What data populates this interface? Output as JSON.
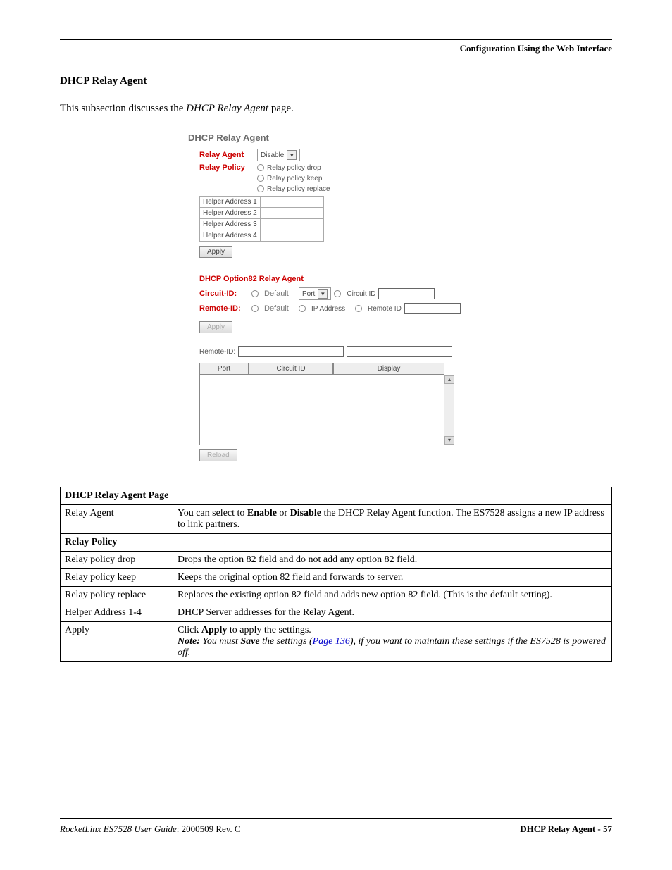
{
  "header": {
    "right": "Configuration Using the Web Interface"
  },
  "section": {
    "title": "DHCP Relay Agent",
    "intro": {
      "pre": "This subsection discusses the ",
      "page_name": "DHCP Relay Agent",
      "post": " page."
    }
  },
  "ui": {
    "title": "DHCP Relay Agent",
    "relay_agent_label": "Relay Agent",
    "relay_agent_value": "Disable",
    "relay_policy_label": "Relay Policy",
    "policy": [
      "Relay policy drop",
      "Relay policy keep",
      "Relay policy replace"
    ],
    "helpers": [
      "Helper Address 1",
      "Helper Address 2",
      "Helper Address 3",
      "Helper Address 4"
    ],
    "apply": "Apply",
    "option82_title": "DHCP Option82 Relay Agent",
    "circuit_label": "Circuit-ID:",
    "remote_label": "Remote-ID:",
    "default": "Default",
    "port": "Port",
    "circuit_id": "Circuit ID",
    "remote_id": "Remote ID",
    "ip_address": "IP Address",
    "remote_id_field": "Remote-ID:",
    "cols": [
      "Port",
      "Circuit ID",
      "Display"
    ],
    "reload": "Reload"
  },
  "table": {
    "title": "DHCP Relay Agent Page",
    "policy_header": "Relay Policy",
    "rows": [
      {
        "label": "Relay Agent",
        "pre": "You can select to ",
        "b1": "Enable",
        "mid": " or ",
        "b2": "Disable",
        "post": " the DHCP Relay Agent function. The ES7528 assigns a new IP address to link partners."
      },
      {
        "label": "Relay policy drop",
        "desc": "Drops the option 82 field and do not add any option 82 field."
      },
      {
        "label": "Relay policy keep",
        "desc": "Keeps the original option 82 field and forwards to server."
      },
      {
        "label": "Relay policy replace",
        "desc": "Replaces the existing option 82 field and adds new option 82 field. (This is the default setting)."
      },
      {
        "label": "Helper Address 1-4",
        "desc": "DHCP Server addresses for the Relay Agent."
      },
      {
        "label": "Apply",
        "line1a": "Click ",
        "apply": "Apply",
        "line1b": " to apply the settings.",
        "note_label": "Note: ",
        "note_a": " You must ",
        "save": "Save",
        "note_b": " the settings (",
        "link": "Page 136",
        "note_c": "), if you want to maintain these settings if the ES7528 is powered off."
      }
    ]
  },
  "footer": {
    "left_italic": "RocketLinx ES7528  User Guide",
    "left_rest": ": 2000509 Rev. C",
    "right": "DHCP Relay Agent - 57"
  }
}
